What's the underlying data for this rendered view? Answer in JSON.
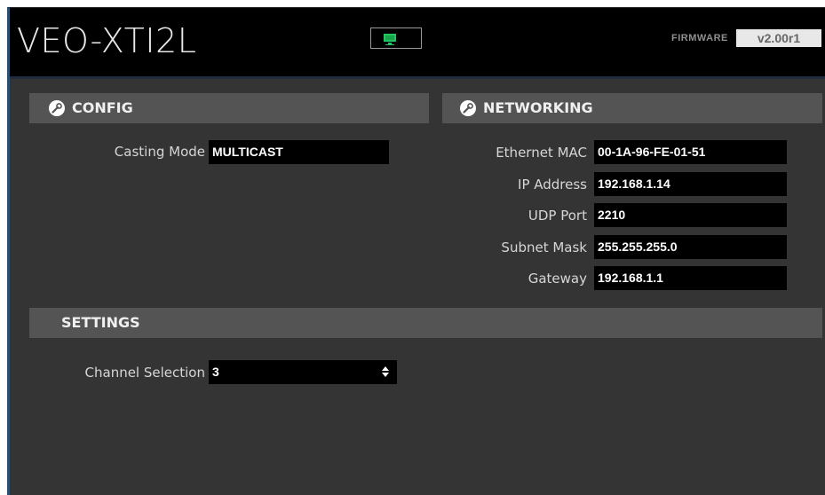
{
  "header": {
    "title": "VEO-XTI2L",
    "firmware_label": "FIRMWARE",
    "firmware_version": "v2.00r1",
    "status_icon": "monitor-icon",
    "status_color": "#22c55e"
  },
  "config": {
    "heading": "CONFIG",
    "icon": "wrench-icon",
    "fields": [
      {
        "label": "Casting Mode",
        "value": "MULTICAST"
      }
    ]
  },
  "networking": {
    "heading": "NETWORKING",
    "icon": "wrench-icon",
    "fields": [
      {
        "label": "Ethernet MAC",
        "value": "00-1A-96-FE-01-51"
      },
      {
        "label": "IP Address",
        "value": "192.168.1.14"
      },
      {
        "label": "UDP Port",
        "value": "2210"
      },
      {
        "label": "Subnet Mask",
        "value": "255.255.255.0"
      },
      {
        "label": "Gateway",
        "value": "192.168.1.1"
      }
    ]
  },
  "settings": {
    "heading": "SETTINGS",
    "channel_label": "Channel Selection",
    "channel_value": "3"
  },
  "colors": {
    "background": "#343434",
    "header_bar": "#000000",
    "section_header": "#545454",
    "field_bg": "#000000"
  }
}
